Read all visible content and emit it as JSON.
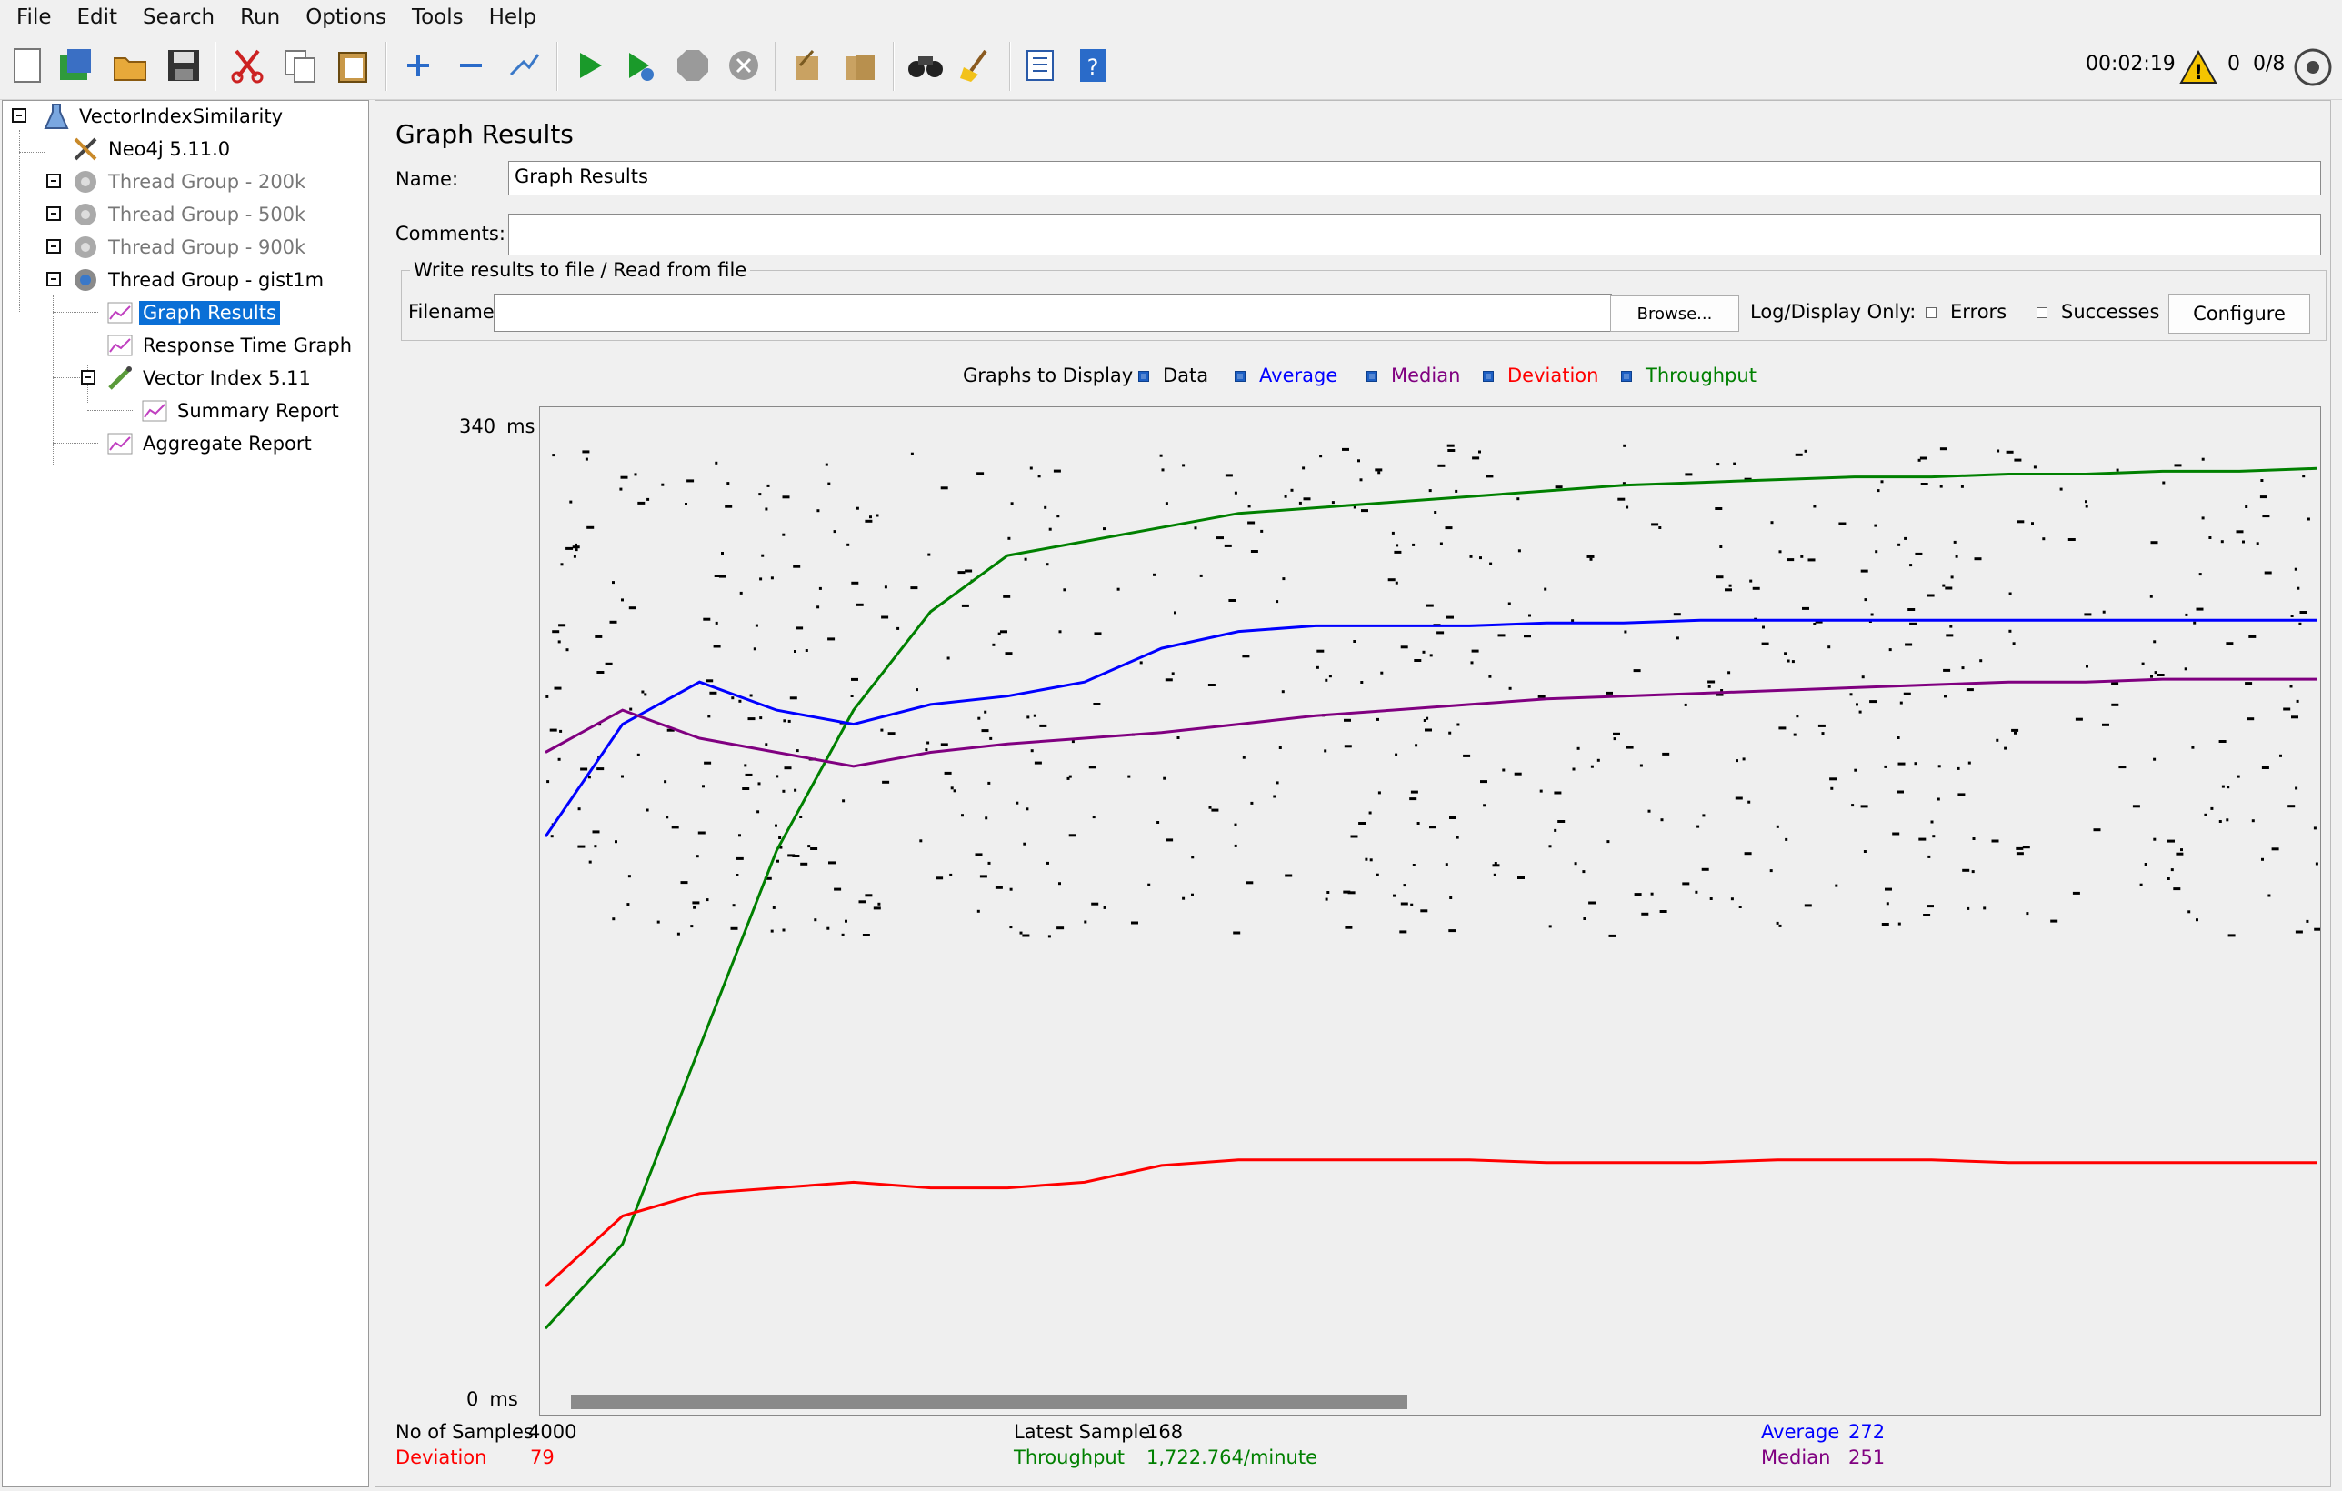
{
  "menu": [
    "File",
    "Edit",
    "Search",
    "Run",
    "Options",
    "Tools",
    "Help"
  ],
  "toolbar": {
    "timer": "00:02:19",
    "warnings": "0",
    "threads": "0/8",
    "icons": [
      "new-icon",
      "templates-icon",
      "open-icon",
      "save-icon",
      "cut-icon",
      "copy-icon",
      "paste-icon",
      "expand-icon",
      "collapse-icon",
      "toggle-icon",
      "start-icon",
      "start-no-pause-icon",
      "stop-icon",
      "shutdown-icon",
      "clear-icon",
      "clear-all-icon",
      "search-icon",
      "reset-search-icon",
      "function-helper-icon",
      "help-icon"
    ]
  },
  "tree": {
    "root": "VectorIndexSimilarity",
    "items": [
      {
        "label": "Neo4j 5.11.0",
        "icon": "config-tools-icon"
      },
      {
        "label": "Thread Group - 200k",
        "icon": "gear-icon",
        "disabled": true
      },
      {
        "label": "Thread Group - 500k",
        "icon": "gear-icon",
        "disabled": true
      },
      {
        "label": "Thread Group - 900k",
        "icon": "gear-icon",
        "disabled": true
      },
      {
        "label": "Thread Group - gist1m",
        "icon": "gear-icon"
      },
      {
        "label": "Graph Results",
        "icon": "graph-icon",
        "selected": true
      },
      {
        "label": "Response Time Graph",
        "icon": "graph-icon"
      },
      {
        "label": "Vector Index 5.11",
        "icon": "sampler-icon"
      },
      {
        "label": "Summary Report",
        "icon": "graph-icon"
      },
      {
        "label": "Aggregate Report",
        "icon": "graph-icon"
      }
    ]
  },
  "panel": {
    "title": "Graph Results",
    "name_label": "Name:",
    "name_value": "Graph Results",
    "comments_label": "Comments:",
    "comments_value": "",
    "file_group_title": "Write results to file / Read from file",
    "filename_label": "Filename",
    "filename_value": "",
    "browse_label": "Browse...",
    "log_display_label": "Log/Display Only:",
    "errors_label": "Errors",
    "successes_label": "Successes",
    "configure_label": "Configure"
  },
  "graphs_to_display": {
    "label": "Graphs to Display",
    "options": [
      {
        "name": "Data",
        "color": "#000000",
        "checked": true
      },
      {
        "name": "Average",
        "color": "#0000ff",
        "checked": true
      },
      {
        "name": "Median",
        "color": "#800080",
        "checked": true
      },
      {
        "name": "Deviation",
        "color": "#ff0000",
        "checked": true
      },
      {
        "name": "Throughput",
        "color": "#008000",
        "checked": true
      }
    ]
  },
  "chart_data": {
    "type": "line",
    "ylabel_max": "340",
    "ylabel_min": "0",
    "y_unit": "ms",
    "ylim": [
      0,
      340
    ],
    "grid": false,
    "series": [
      {
        "name": "Throughput",
        "color": "#008000",
        "values": [
          20,
          50,
          120,
          190,
          240,
          275,
          295,
          300,
          305,
          310,
          312,
          314,
          316,
          318,
          320,
          321,
          322,
          323,
          323,
          324,
          324,
          325,
          325,
          326
        ]
      },
      {
        "name": "Average",
        "color": "#0000ff",
        "values": [
          195,
          235,
          250,
          240,
          235,
          242,
          245,
          250,
          262,
          268,
          270,
          270,
          270,
          271,
          271,
          272,
          272,
          272,
          272,
          272,
          272,
          272,
          272,
          272
        ]
      },
      {
        "name": "Median",
        "color": "#800080",
        "values": [
          225,
          240,
          230,
          225,
          220,
          225,
          228,
          230,
          232,
          235,
          238,
          240,
          242,
          244,
          245,
          246,
          247,
          248,
          249,
          250,
          250,
          251,
          251,
          251
        ]
      },
      {
        "name": "Deviation",
        "color": "#ff0000",
        "values": [
          35,
          60,
          68,
          70,
          72,
          70,
          70,
          72,
          78,
          80,
          80,
          80,
          80,
          79,
          79,
          79,
          80,
          80,
          80,
          79,
          79,
          79,
          79,
          79
        ]
      }
    ]
  },
  "stats": {
    "samples_label": "No of Samples",
    "samples_value": "4000",
    "latest_label": "Latest Sample",
    "latest_value": "168",
    "average_label": "Average",
    "average_value": "272",
    "deviation_label": "Deviation",
    "deviation_value": "79",
    "throughput_label": "Throughput",
    "throughput_value": "1,722.764/minute",
    "median_label": "Median",
    "median_value": "251"
  }
}
